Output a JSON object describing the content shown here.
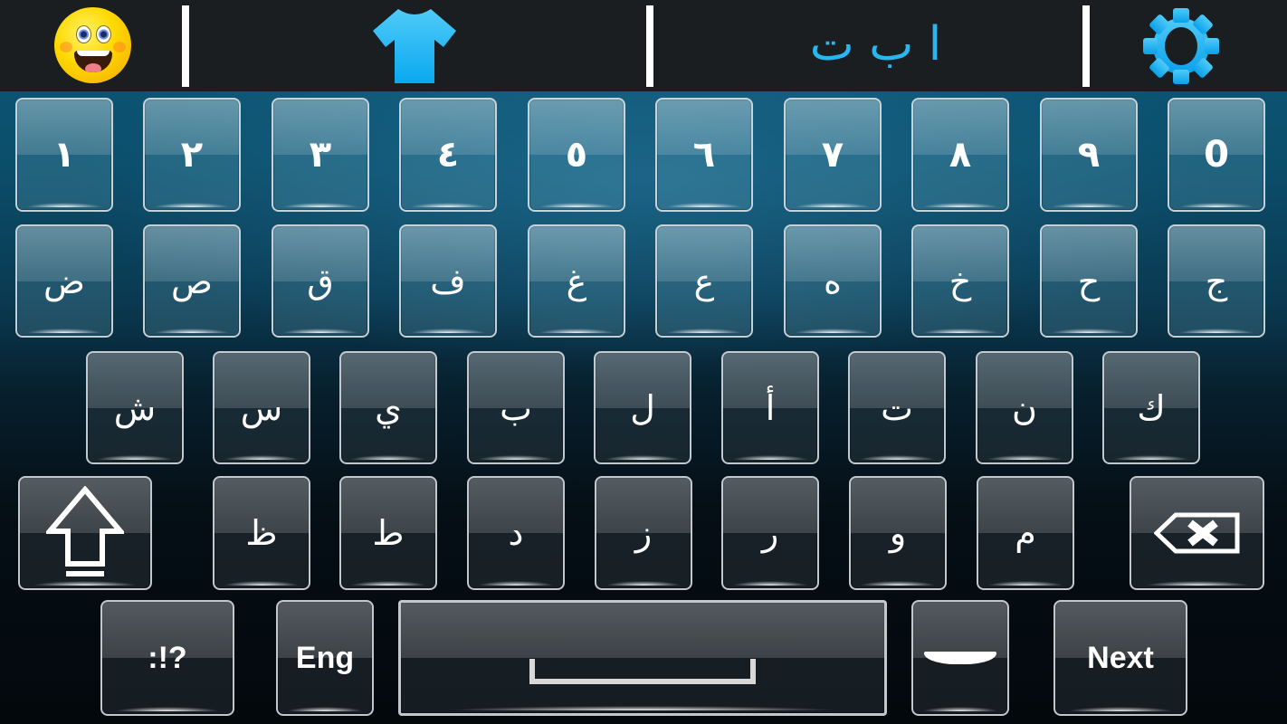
{
  "toolbar": {
    "emoji_icon": "smiley-face-icon",
    "theme_icon": "tshirt-icon",
    "language_indicator": "ا ب ت",
    "settings_icon": "gear-icon",
    "accent_color": "#29b6f0",
    "background_color": "#1a1e21"
  },
  "keyboard": {
    "layout": "Arabic",
    "row1": [
      "١",
      "٢",
      "٣",
      "٤",
      "٥",
      "٦",
      "٧",
      "٨",
      "٩",
      "0"
    ],
    "row2": [
      "ض",
      "ص",
      "ق",
      "ف",
      "غ",
      "ع",
      "ه",
      "خ",
      "ح",
      "ج"
    ],
    "row3": [
      "ش",
      "س",
      "ي",
      "ب",
      "ل",
      "أ",
      "ت",
      "ن",
      "ك"
    ],
    "row4": {
      "shift_icon": "shift-arrow-icon",
      "letters": [
        "ظ",
        "ط",
        "د",
        "ز",
        "ر",
        "و",
        "م"
      ],
      "backspace_icon": "backspace-icon"
    },
    "row5": {
      "symbols_label": ":!?",
      "language_label": "Eng",
      "space_icon": "space-bar-icon",
      "enter_icon": "enter-icon",
      "next_label": "Next"
    }
  }
}
